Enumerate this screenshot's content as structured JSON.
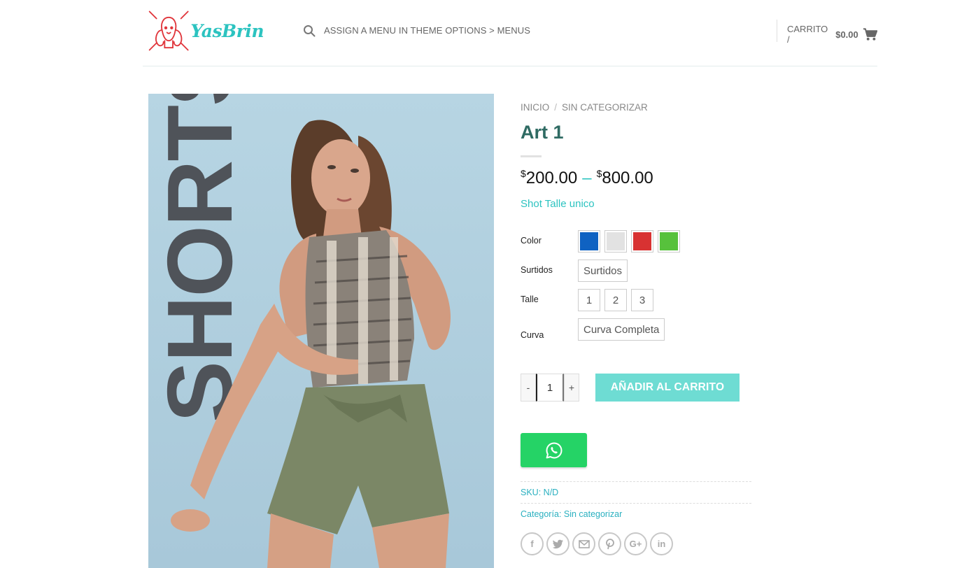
{
  "header": {
    "logo_text": "YasBrin",
    "nav_text": "ASSIGN A MENU IN THEME OPTIONS > MENUS",
    "cart_label": "CARRITO /",
    "cart_amount": "$0.00"
  },
  "image": {
    "overlay_text": "SHORTS"
  },
  "breadcrumb": {
    "home": "INICIO",
    "separator": "/",
    "category": "SIN CATEGORIZAR"
  },
  "product": {
    "title": "Art 1",
    "price_currency": "$",
    "price_min": "200.00",
    "price_dash": "–",
    "price_max": "800.00",
    "short_description": "Shot Talle unico"
  },
  "variations": {
    "color_label": "Color",
    "colors": [
      {
        "name": "blue",
        "hex": "#0f62c2"
      },
      {
        "name": "light-gray",
        "hex": "#e2e2e2"
      },
      {
        "name": "red",
        "hex": "#d83232"
      },
      {
        "name": "green",
        "hex": "#57c13c"
      }
    ],
    "surtidos_label": "Surtidos",
    "surtidos_options": [
      "Surtidos"
    ],
    "talle_label": "Talle",
    "talle_options": [
      "1",
      "2",
      "3"
    ],
    "curva_label": "Curva",
    "curva_options": [
      "Curva Completa"
    ]
  },
  "cart": {
    "minus": "-",
    "quantity": "1",
    "plus": "+",
    "add_label": "AÑADIR AL CARRITO"
  },
  "meta": {
    "sku_label": "SKU:",
    "sku_value": "N/D",
    "category_label": "Categoría:",
    "category_value": "Sin categorizar"
  },
  "share": {
    "facebook": "f",
    "google_plus": "G+",
    "linkedin": "in"
  },
  "colors": {
    "accent": "#2cc3c0",
    "title": "#2f6b63",
    "button": "#6edcd3",
    "whatsapp": "#25d366"
  }
}
